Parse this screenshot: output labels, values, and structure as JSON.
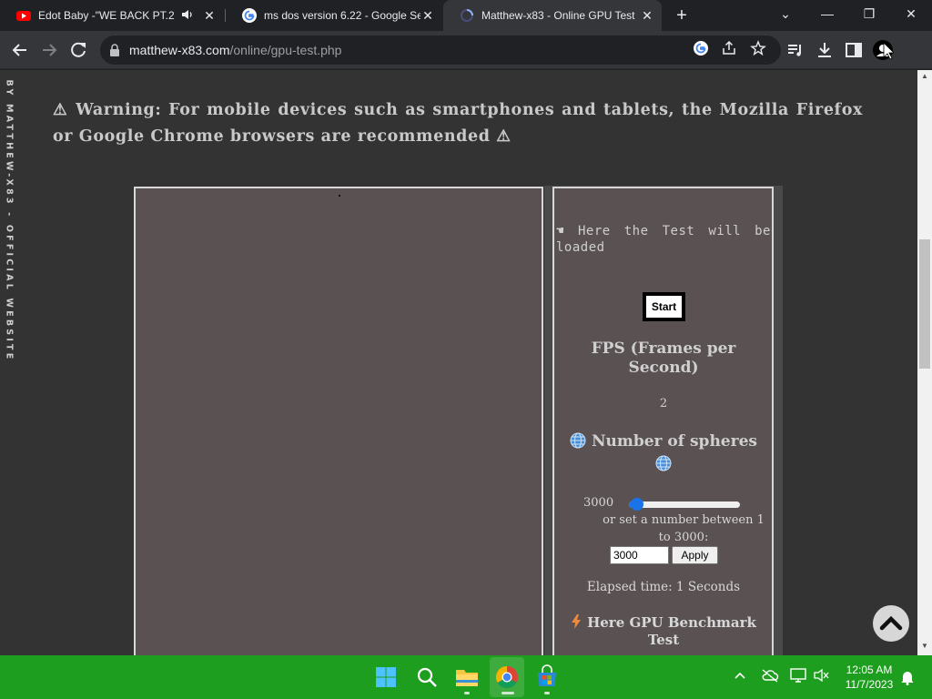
{
  "tabs": [
    {
      "title": "Edot Baby -\"WE BACK PT.2\"",
      "favicon": "youtube-icon",
      "audio": "speaker-icon"
    },
    {
      "title": "ms dos version 6.22 - Google Se",
      "favicon": "google-icon"
    },
    {
      "title": "Matthew-x83 - Online GPU Test",
      "favicon": "loading-spinner-icon",
      "active": true
    }
  ],
  "address_bar": {
    "host": "matthew-x83.com",
    "path": "/online/gpu-test.php"
  },
  "page": {
    "side_text": "BY MATTHEW-X83 - OFFICIAL WEBSITE",
    "warning": "⚠ Warning: For mobile devices such as smartphones and tablets, the Mozilla Firefox or Google Chrome browsers are recommended ⚠",
    "test_loaded_msg": "☚ Here the Test will be loaded",
    "start_label": "Start",
    "fps_title": "FPS (Frames per Second)",
    "fps_value": "2",
    "spheres_title": "Number of spheres",
    "spheres_slider_value": "3000",
    "spheres_slider_fraction": 0.02,
    "range_note": "or set a number between 1 to 3000:",
    "spheres_input_value": "3000",
    "apply_label": "Apply",
    "elapsed": "Elapsed time: 1 Seconds",
    "benchmark_title": "Here GPU Benchmark Test"
  },
  "taskbar": {
    "time": "12:05 AM",
    "date": "11/7/2023"
  },
  "colors": {
    "page_bg": "#333333",
    "canvas_bg": "#595152",
    "taskbar_bg": "#1e9e1e",
    "slider_accent": "#1a73e8"
  }
}
